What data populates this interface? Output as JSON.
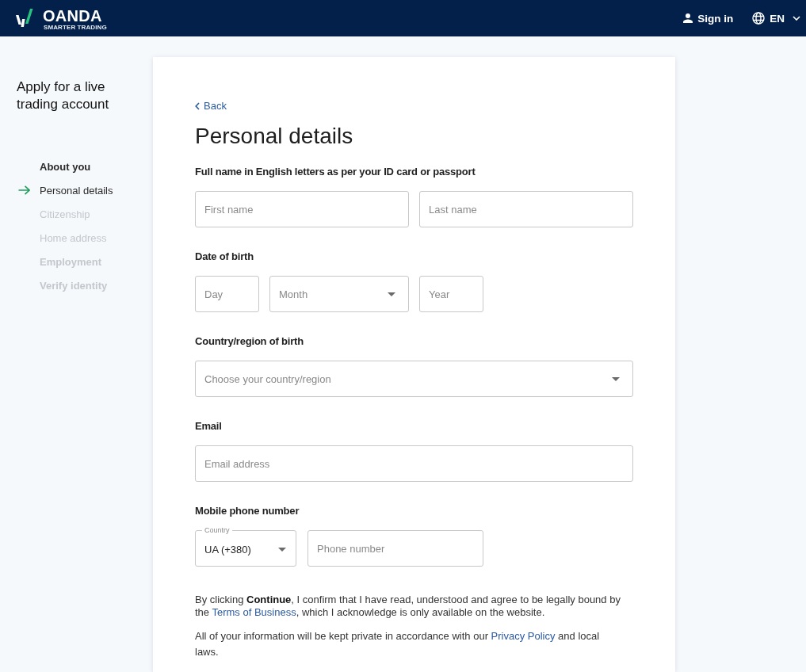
{
  "header": {
    "logo_name": "OANDA",
    "logo_tagline": "SMARTER TRADING",
    "sign_in": "Sign in",
    "language": "EN"
  },
  "sidebar": {
    "title": "Apply for a live trading account",
    "steps": [
      {
        "label": "About you",
        "active": true,
        "children": [
          {
            "label": "Personal details",
            "selected": true
          },
          {
            "label": "Citizenship",
            "selected": false
          },
          {
            "label": "Home address",
            "selected": false
          }
        ]
      },
      {
        "label": "Employment",
        "active": false
      },
      {
        "label": "Verify identity",
        "active": false
      }
    ]
  },
  "form": {
    "back": "Back",
    "title": "Personal details",
    "groups": [
      {
        "kind": "name",
        "label": "Full name in English letters as per your ID card or passport",
        "fields": [
          {
            "kind": "input",
            "placeholder": "First name"
          },
          {
            "kind": "input",
            "placeholder": "Last name"
          }
        ]
      },
      {
        "kind": "date",
        "label": "Date of birth",
        "fields": [
          {
            "kind": "input",
            "placeholder": "Day"
          },
          {
            "kind": "select",
            "placeholder": "Month"
          },
          {
            "kind": "input",
            "placeholder": "Year"
          }
        ]
      },
      {
        "kind": "wide",
        "label": "Country/region of birth",
        "fields": [
          {
            "kind": "select",
            "placeholder": "Choose your country/region"
          }
        ]
      },
      {
        "kind": "wide",
        "label": "Email",
        "fields": [
          {
            "kind": "input",
            "placeholder": "Email address"
          }
        ]
      },
      {
        "kind": "phone",
        "label": "Mobile phone number",
        "fields": [
          {
            "kind": "labeled_select",
            "label": "Country",
            "value": "UA (+380)"
          },
          {
            "kind": "input",
            "placeholder": "Phone number"
          }
        ]
      }
    ],
    "legal": [
      [
        {
          "kind": "text",
          "text": "By clicking **Continue**, I confirm that I have read, understood and agree to be legally bound by the "
        },
        {
          "kind": "link",
          "text": "Terms of Business"
        },
        {
          "kind": "text",
          "text": ", which I acknowledge is only available on the website."
        }
      ],
      [
        {
          "kind": "text",
          "text": "All of your information will be kept private in accordance with our "
        },
        {
          "kind": "link",
          "text": "Privacy Policy"
        },
        {
          "kind": "text",
          "text": " and local laws."
        }
      ]
    ]
  }
}
